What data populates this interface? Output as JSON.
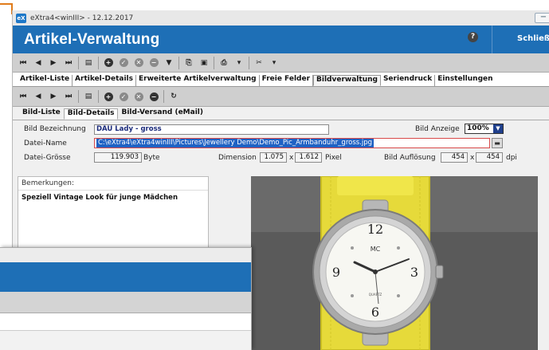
{
  "window": {
    "title": "eXtra4<winIII> - 12.12.2017",
    "app_icon": "eX"
  },
  "header": {
    "title": "Artikel-Verwaltung",
    "help_label": "?",
    "close_label": "Schließen"
  },
  "main_tabs": [
    {
      "label": "Artikel-Liste",
      "active": false
    },
    {
      "label": "Artikel-Details",
      "active": false
    },
    {
      "label": "Erweiterte Artikelverwaltung",
      "active": false
    },
    {
      "label": "Freie Felder",
      "active": false
    },
    {
      "label": "Bildverwaltung",
      "active": true
    },
    {
      "label": "Seriendruck",
      "active": false
    },
    {
      "label": "Einstellungen",
      "active": false
    }
  ],
  "sub_tabs": [
    {
      "label": "Bild-Liste",
      "active": false
    },
    {
      "label": "Bild-Details",
      "active": true
    },
    {
      "label": "Bild-Versand (eMail)",
      "active": false
    }
  ],
  "form": {
    "bild_bezeichnung_label": "Bild Bezeichnung",
    "bild_bezeichnung_value": "DAU Lady - gross",
    "bild_anzeige_label": "Bild Anzeige",
    "bild_anzeige_value": "100%",
    "datei_name_label": "Datei-Name",
    "datei_name_value": "C:\\eXtra4\\eXtra4winIII\\Pictures\\Jewellery Demo\\Demo_Pic_Armbanduhr_gross.jpg",
    "datei_groesse_label": "Datei-Grösse",
    "datei_groesse_value": "119.903",
    "datei_groesse_unit": "Byte",
    "dimension_label": "Dimension",
    "dimension_w": "1.075",
    "dimension_x": "x",
    "dimension_h": "1.612",
    "dimension_unit": "Pixel",
    "aufloesung_label": "Bild Auflösung",
    "aufloesung_x": "454",
    "aufloesung_sep": "x",
    "aufloesung_y": "454",
    "aufloesung_unit": "dpi"
  },
  "remarks": {
    "label": "Bemerkungen:",
    "text": "Speziell Vintage Look für junge Mädchen"
  },
  "photo": {
    "brand": "MC",
    "numerals": [
      "12",
      "3",
      "6",
      "9"
    ],
    "dial_text": "QUARTZ"
  },
  "colors": {
    "header_blue": "#1e6fb6",
    "accent_orange": "#e07b1a",
    "strap_yellow": "#e6da3a"
  }
}
